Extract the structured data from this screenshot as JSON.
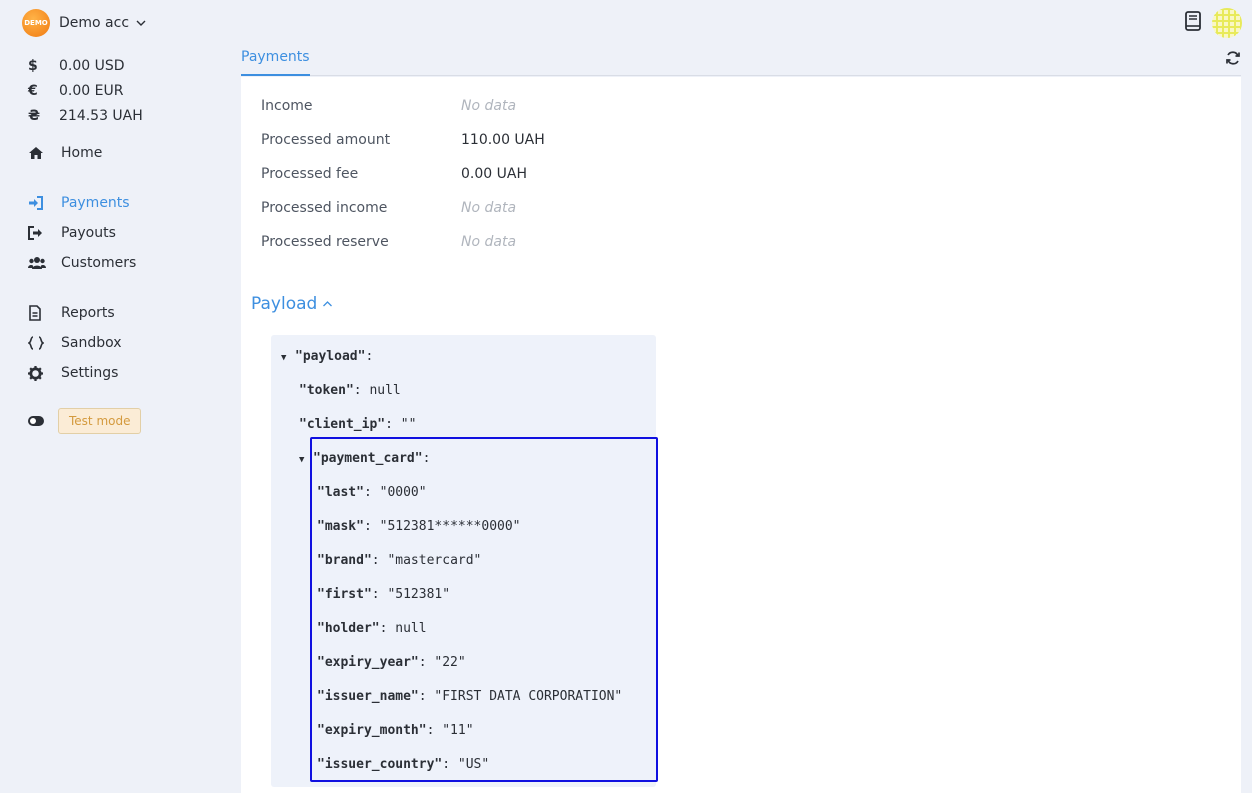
{
  "account": {
    "logo_text": "DEMO",
    "name": "Demo acc"
  },
  "balances": [
    {
      "symbol": "$",
      "value": "0.00 USD"
    },
    {
      "symbol": "€",
      "value": "0.00 EUR"
    },
    {
      "symbol": "₴",
      "value": "214.53 UAH"
    }
  ],
  "nav": {
    "home": "Home",
    "payments": "Payments",
    "payouts": "Payouts",
    "customers": "Customers",
    "reports": "Reports",
    "sandbox": "Sandbox",
    "settings": "Settings"
  },
  "test_mode": {
    "label": "Test mode"
  },
  "tabs": {
    "active": "Payments"
  },
  "stats": [
    {
      "label": "Income",
      "value": "No data",
      "empty": true
    },
    {
      "label": "Processed amount",
      "value": "110.00 UAH",
      "empty": false
    },
    {
      "label": "Processed fee",
      "value": "0.00 UAH",
      "empty": false
    },
    {
      "label": "Processed income",
      "value": "No data",
      "empty": true
    },
    {
      "label": "Processed reserve",
      "value": "No data",
      "empty": true
    }
  ],
  "payload_section": {
    "title": "Payload"
  },
  "json": {
    "root_key": "\"payload\"",
    "token_key": "\"token\"",
    "token_val": "null",
    "client_ip_key": "\"client_ip\"",
    "client_ip_val": "\"\"",
    "card_key": "\"payment_card\"",
    "card_fields": [
      {
        "key": "\"last\"",
        "value": "\"0000\""
      },
      {
        "key": "\"mask\"",
        "value": "\"512381******0000\""
      },
      {
        "key": "\"brand\"",
        "value": "\"mastercard\""
      },
      {
        "key": "\"first\"",
        "value": "\"512381\""
      },
      {
        "key": "\"holder\"",
        "value": "null"
      },
      {
        "key": "\"expiry_year\"",
        "value": "\"22\""
      },
      {
        "key": "\"issuer_name\"",
        "value": "\"FIRST DATA CORPORATION\""
      },
      {
        "key": "\"expiry_month\"",
        "value": "\"11\""
      },
      {
        "key": "\"issuer_country\"",
        "value": "\"US\""
      }
    ]
  },
  "colors": {
    "accent": "#3d8fe0",
    "highlight_border": "#1010e0",
    "background": "#eef1f8"
  }
}
